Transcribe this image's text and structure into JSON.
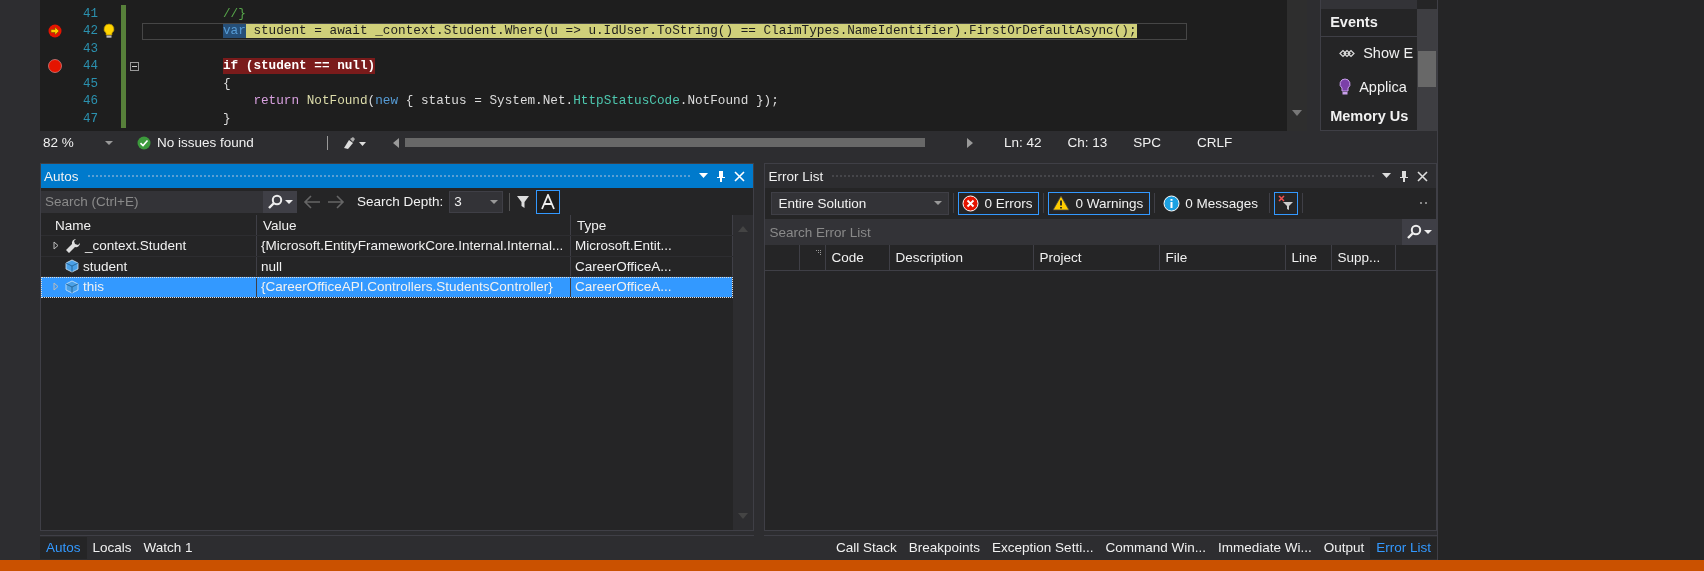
{
  "editor": {
    "lines": [
      {
        "number": "41",
        "breakpoint": false,
        "current": false,
        "lightbulb": false,
        "collapsible": false,
        "tokens": [
          {
            "text": "        //}",
            "kind": "comment"
          }
        ]
      },
      {
        "number": "42",
        "breakpoint": true,
        "current": true,
        "lightbulb": true,
        "collapsible": false,
        "tokens": [
          {
            "text": "        var",
            "kind": "selected"
          },
          {
            "text": " student = await _context.Student.Where(u => u.IdUser.ToString() == ClaimTypes.NameIdentifier).FirstOrDefaultAsync();",
            "kind": "plain"
          }
        ]
      },
      {
        "number": "43",
        "breakpoint": false,
        "current": false,
        "lightbulb": false,
        "collapsible": false
      },
      {
        "number": "44",
        "breakpoint": true,
        "current": false,
        "lightbulb": false,
        "collapsible": true,
        "tokens": [
          {
            "text": "        if (student == null)",
            "kind": "plain"
          }
        ]
      },
      {
        "number": "45",
        "breakpoint": false,
        "current": false,
        "lightbulb": false,
        "collapsible": false,
        "tokens": [
          {
            "text": "        {",
            "kind": "plain"
          }
        ]
      },
      {
        "number": "46",
        "breakpoint": false,
        "current": false,
        "lightbulb": false,
        "collapsible": false,
        "tokens": [
          {
            "text": "            return",
            "kind": "control"
          },
          {
            "text": " NotFound",
            "kind": "method"
          },
          {
            "text": "(",
            "kind": "plain"
          },
          {
            "text": "new",
            "kind": "keyword"
          },
          {
            "text": " { status = System.Net.",
            "kind": "plain"
          },
          {
            "text": "HttpStatusCode",
            "kind": "type"
          },
          {
            "text": ".NotFound });",
            "kind": "plain"
          }
        ]
      },
      {
        "number": "47",
        "breakpoint": false,
        "current": false,
        "lightbulb": false,
        "collapsible": false,
        "tokens": [
          {
            "text": "        }",
            "kind": "plain"
          }
        ]
      }
    ],
    "status": {
      "zoom": "82 %",
      "issues": "No issues found",
      "line": "Ln: 42",
      "column": "Ch: 13",
      "whitespace": "SPC",
      "line_ending": "CRLF"
    }
  },
  "diagnostics": {
    "sections": [
      {
        "title": "Events",
        "items": [
          {
            "label": "Show E"
          },
          {
            "label": "Applica"
          }
        ]
      },
      {
        "title": "Memory Us"
      }
    ]
  },
  "autos": {
    "title": "Autos",
    "search": {
      "placeholder": "Search (Ctrl+E)"
    },
    "search_depth_label": "Search Depth:",
    "search_depth": "3",
    "columns": [
      "Name",
      "Value",
      "Type"
    ],
    "rows": [
      {
        "name": "_context.Student",
        "value": "{Microsoft.EntityFrameworkCore.Internal.Internal...",
        "type": "Microsoft.Entit...",
        "expandable": true,
        "kind": "property",
        "selected": false
      },
      {
        "name": "student",
        "value": "null",
        "type": "CareerOfficeA...",
        "expandable": false,
        "kind": "variable",
        "selected": false
      },
      {
        "name": "this",
        "value": "{CareerOfficeAPI.Controllers.StudentsController}",
        "type": "CareerOfficeA...",
        "expandable": true,
        "kind": "variable",
        "selected": true
      }
    ]
  },
  "error_list": {
    "title": "Error List",
    "scope": "Entire Solution",
    "filters": [
      {
        "kind": "error",
        "label": "0 Errors",
        "on": true
      },
      {
        "kind": "warning",
        "label": "0 Warnings",
        "on": true
      },
      {
        "kind": "info",
        "label": "0 Messages",
        "on": false
      }
    ],
    "search": {
      "placeholder": "Search Error List"
    },
    "columns": [
      "Code",
      "Description",
      "Project",
      "File",
      "Line",
      "Supp..."
    ]
  },
  "left_tabs": [
    {
      "label": "Autos",
      "selected": true
    },
    {
      "label": "Locals",
      "selected": false
    },
    {
      "label": "Watch 1",
      "selected": false
    }
  ],
  "right_tabs": [
    {
      "label": "Call Stack",
      "selected": false
    },
    {
      "label": "Breakpoints",
      "selected": false
    },
    {
      "label": "Exception Setti...",
      "selected": false
    },
    {
      "label": "Command Win...",
      "selected": false
    },
    {
      "label": "Immediate Wi...",
      "selected": false
    },
    {
      "label": "Output",
      "selected": false
    },
    {
      "label": "Error List",
      "selected": true
    }
  ]
}
